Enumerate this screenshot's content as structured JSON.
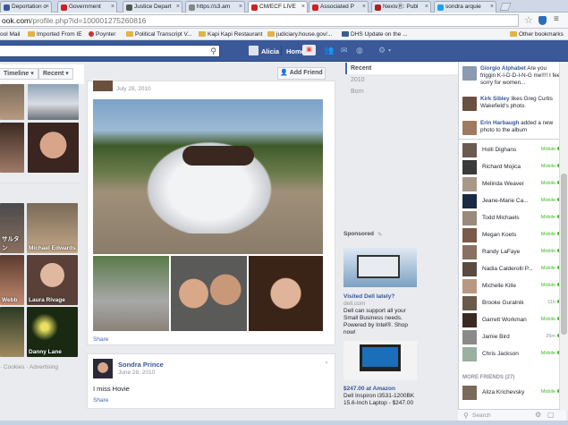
{
  "browser": {
    "tabs": [
      {
        "label": "Deportation o",
        "color": "#3b5998"
      },
      {
        "label": "Government",
        "color": "#cc2222"
      },
      {
        "label": "Justice Depart",
        "color": "#555555"
      },
      {
        "label": "https://s3.am",
        "color": "#888888"
      },
      {
        "label": "CM/ECF LIVE",
        "color": "#cc2222"
      },
      {
        "label": "Associated P",
        "color": "#cc2222"
      },
      {
        "label": "NexisⓇ: Publ",
        "color": "#aa2222"
      },
      {
        "label": "sondra arquie",
        "color": "#1da1f2"
      }
    ],
    "url_domain": "ook.com",
    "url_path": "/profile.php?id=100001275260816",
    "bookmarks": [
      "ool Mail",
      "Imported From IE",
      "Poynter",
      "Political Transcript V...",
      "Kapi Kapi Restaurant",
      "judiciary.house.gov/...",
      "DHS Update on the ...",
      "Other bookmarks"
    ]
  },
  "fb": {
    "user": "Alicia",
    "home": "Home"
  },
  "profile": {
    "timeline_label": "Timeline",
    "recent_label": "Recent",
    "add_friend": "Add Friend",
    "photos": [
      {
        "label": ""
      },
      {
        "label": ""
      },
      {
        "label": ""
      },
      {
        "label": ""
      },
      {
        "label": "サルタン"
      },
      {
        "label": "Michael Edwards"
      },
      {
        "label": "Webb"
      },
      {
        "label": "Laura Rivage"
      },
      {
        "label": ""
      },
      {
        "label": "Danny Lane"
      }
    ],
    "footer": "· Cookies · Advertising"
  },
  "posts": [
    {
      "date": "July 28, 2010",
      "share": "Share"
    },
    {
      "name": "Sondra Prince",
      "date": "June 28, 2010",
      "text": "I miss Hovie",
      "share": "Share"
    }
  ],
  "years": [
    "Recent",
    "2010",
    "Born"
  ],
  "sponsored": {
    "header": "Sponsored",
    "ad1_title": "Visited Dell lately?",
    "ad1_domain": "dell.com",
    "ad1_body": "Dell can support all your Small Business needs. Powered by Intel®. Shop now!",
    "ad2_title": "$247.00 at Amazon",
    "ad2_body": "Dell Inspiron i3531-1200BK 15.6-Inch Laptop - $247.00"
  },
  "ticker": [
    {
      "name": "Giorgio Alphabet",
      "text": "Are you friggin K-I-D-D-I-N-G me!!!! I feel sorry for women..."
    },
    {
      "name": "Kirk Sibley",
      "text": "likes Greg Curtis Wakefield's photo."
    },
    {
      "name": "Erin Harbaugh",
      "text": "added a new photo to the album"
    }
  ],
  "chat": [
    {
      "name": "Holli Dighans",
      "status": "Mobile"
    },
    {
      "name": "Richard Mojica",
      "status": "Mobile"
    },
    {
      "name": "Melinda Weaver",
      "status": "Mobile"
    },
    {
      "name": "Jeane-Marie Ca...",
      "status": "Mobile"
    },
    {
      "name": "Todd Michaels",
      "status": "Mobile"
    },
    {
      "name": "Megan Koets",
      "status": "Mobile"
    },
    {
      "name": "Randy LaFaye",
      "status": "Mobile"
    },
    {
      "name": "Nadia Calderolli P...",
      "status": "Mobile"
    },
    {
      "name": "Michelle Kille",
      "status": "Mobile"
    },
    {
      "name": "Brooke Guralnik",
      "status": "11h"
    },
    {
      "name": "Garrett Workman",
      "status": "Mobile"
    },
    {
      "name": "Jamie Bird",
      "status": "26m"
    },
    {
      "name": "Chris Jackson",
      "status": "Mobile"
    }
  ],
  "more_friends": "MORE FRIENDS (27)",
  "more": [
    {
      "name": "Aliza Krichevsky",
      "status": "Mobile"
    }
  ],
  "chat_search": "Search"
}
